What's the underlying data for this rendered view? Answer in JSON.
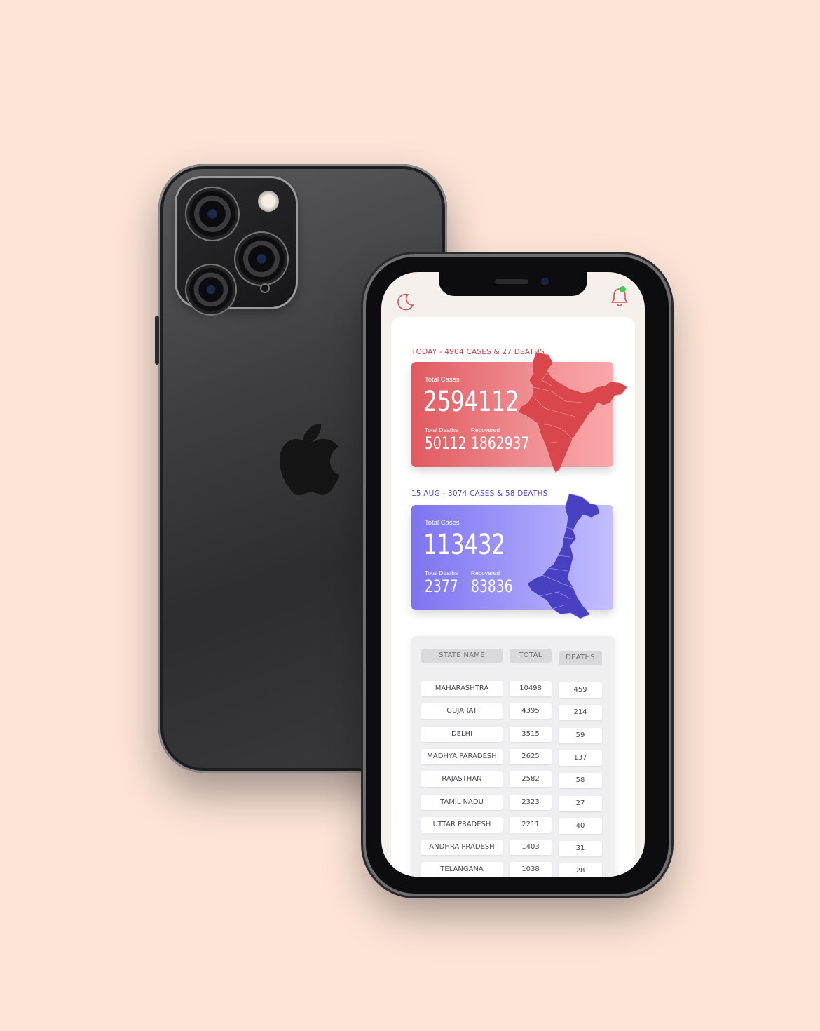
{
  "header": {
    "moon_icon": "moon-icon",
    "bell_icon": "bell-icon",
    "notification_color": "#3cd24a"
  },
  "india": {
    "title": "TODAY - 4904 CASES & 27 DEATHS",
    "total_label": "Total Cases",
    "total": "2594112",
    "deaths_label": "Total Deaths",
    "deaths": "50112",
    "recovered_label": "Recovered",
    "recovered": "1862937",
    "accent": "#e05a60"
  },
  "state": {
    "title": "15 AUG - 3074 CASES & 58 DEATHS",
    "total_label": "Total Cases",
    "total": "113432",
    "deaths_label": "Total Deaths",
    "deaths": "2377",
    "recovered_label": "Recovered",
    "recovered": "83836",
    "accent": "#7d74f0"
  },
  "table": {
    "headers": [
      "STATE NAME",
      "TOTAL",
      "DEATHS"
    ],
    "rows": [
      {
        "name": "MAHARASHTRA",
        "total": "10498",
        "deaths": "459"
      },
      {
        "name": "GUJARAT",
        "total": "4395",
        "deaths": "214"
      },
      {
        "name": "DELHI",
        "total": "3515",
        "deaths": "59"
      },
      {
        "name": "MADHYA PARADESH",
        "total": "2625",
        "deaths": "137"
      },
      {
        "name": "RAJASTHAN",
        "total": "2582",
        "deaths": "58"
      },
      {
        "name": "TAMIL NADU",
        "total": "2323",
        "deaths": "27"
      },
      {
        "name": "UTTAR PRADESH",
        "total": "2211",
        "deaths": "40"
      },
      {
        "name": "ANDHRA PRADESH",
        "total": "1403",
        "deaths": "31"
      },
      {
        "name": "TELANGANA",
        "total": "1038",
        "deaths": "28"
      }
    ]
  }
}
